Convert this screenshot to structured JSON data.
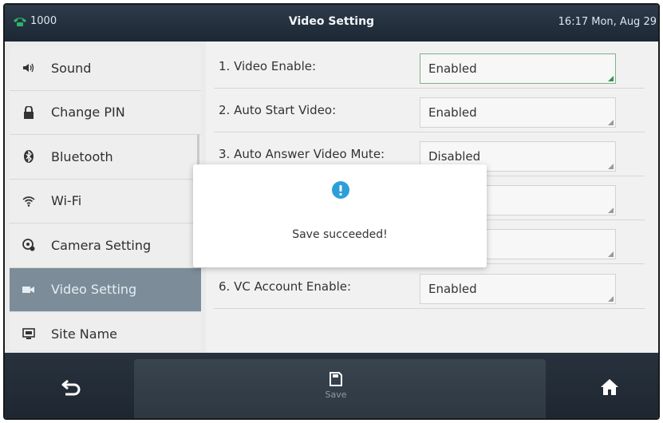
{
  "status_bar": {
    "line_number": "1000",
    "title": "Video Setting",
    "clock": "16:17 Mon, Aug 29"
  },
  "sidebar": {
    "items": [
      {
        "label": "Sound",
        "icon": "speaker-icon"
      },
      {
        "label": "Change PIN",
        "icon": "lock-icon"
      },
      {
        "label": "Bluetooth",
        "icon": "bluetooth-icon"
      },
      {
        "label": "Wi-Fi",
        "icon": "wifi-icon"
      },
      {
        "label": "Camera Setting",
        "icon": "camera-icon"
      },
      {
        "label": "Video Setting",
        "icon": "video-icon",
        "active": true
      },
      {
        "label": "Site Name",
        "icon": "monitor-icon"
      }
    ]
  },
  "settings": [
    {
      "label": "1. Video Enable:",
      "value": "Enabled",
      "focused": true
    },
    {
      "label": "2. Auto Start Video:",
      "value": "Enabled"
    },
    {
      "label": "3. Auto Answer Video Mute:",
      "value": "Disabled"
    },
    {
      "label": "",
      "value": ""
    },
    {
      "label": "",
      "value": ""
    },
    {
      "label": "6. VC Account Enable:",
      "value": "Enabled"
    }
  ],
  "bottom_bar": {
    "save_label": "Save"
  },
  "dialog": {
    "message": "Save succeeded!"
  },
  "colors": {
    "accent_green": "#3a8d5a",
    "dialog_icon": "#2b9fd9",
    "active_item": "#7c8d99"
  }
}
